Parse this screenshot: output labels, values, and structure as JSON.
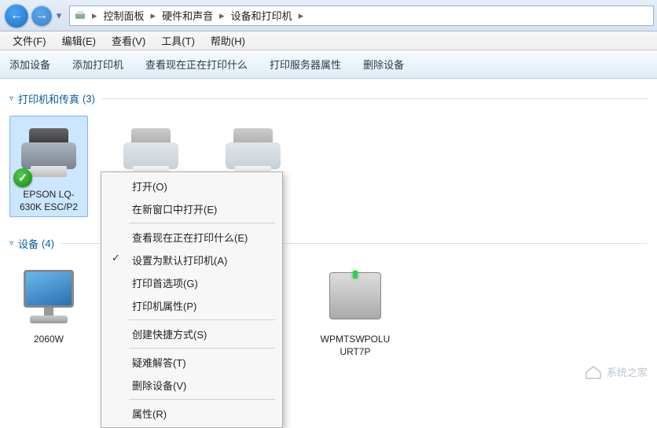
{
  "breadcrumb": {
    "items": [
      "控制面板",
      "硬件和声音",
      "设备和打印机"
    ]
  },
  "menubar": {
    "file": "文件(F)",
    "edit": "编辑(E)",
    "view": "查看(V)",
    "tools": "工具(T)",
    "help": "帮助(H)"
  },
  "toolbar": {
    "add_device": "添加设备",
    "add_printer": "添加打印机",
    "see_print_queue": "查看现在正在打印什么",
    "print_server_props": "打印服务器属性",
    "remove_device": "删除设备"
  },
  "sections": {
    "printers": {
      "label": "打印机和传真",
      "count": "(3)"
    },
    "devices": {
      "label": "设备",
      "count": "(4)"
    }
  },
  "printers": [
    {
      "name": "EPSON LQ-630K ESC/P2",
      "selected": true,
      "default": true
    },
    {
      "name": "",
      "faded": true
    },
    {
      "name": "",
      "faded": true
    }
  ],
  "devices": [
    {
      "name": "2060W",
      "type": "monitor"
    },
    {
      "name": "WPMTSWPOLUURT7P",
      "type": "drive"
    }
  ],
  "context_menu": {
    "open": "打开(O)",
    "open_new_window": "在新窗口中打开(E)",
    "see_queue": "查看现在正在打印什么(E)",
    "set_default": "设置为默认打印机(A)",
    "print_prefs": "打印首选项(G)",
    "printer_props": "打印机属性(P)",
    "create_shortcut": "创建快捷方式(S)",
    "troubleshoot": "疑难解答(T)",
    "remove": "删除设备(V)",
    "properties": "属性(R)"
  },
  "watermark": "系统之家"
}
